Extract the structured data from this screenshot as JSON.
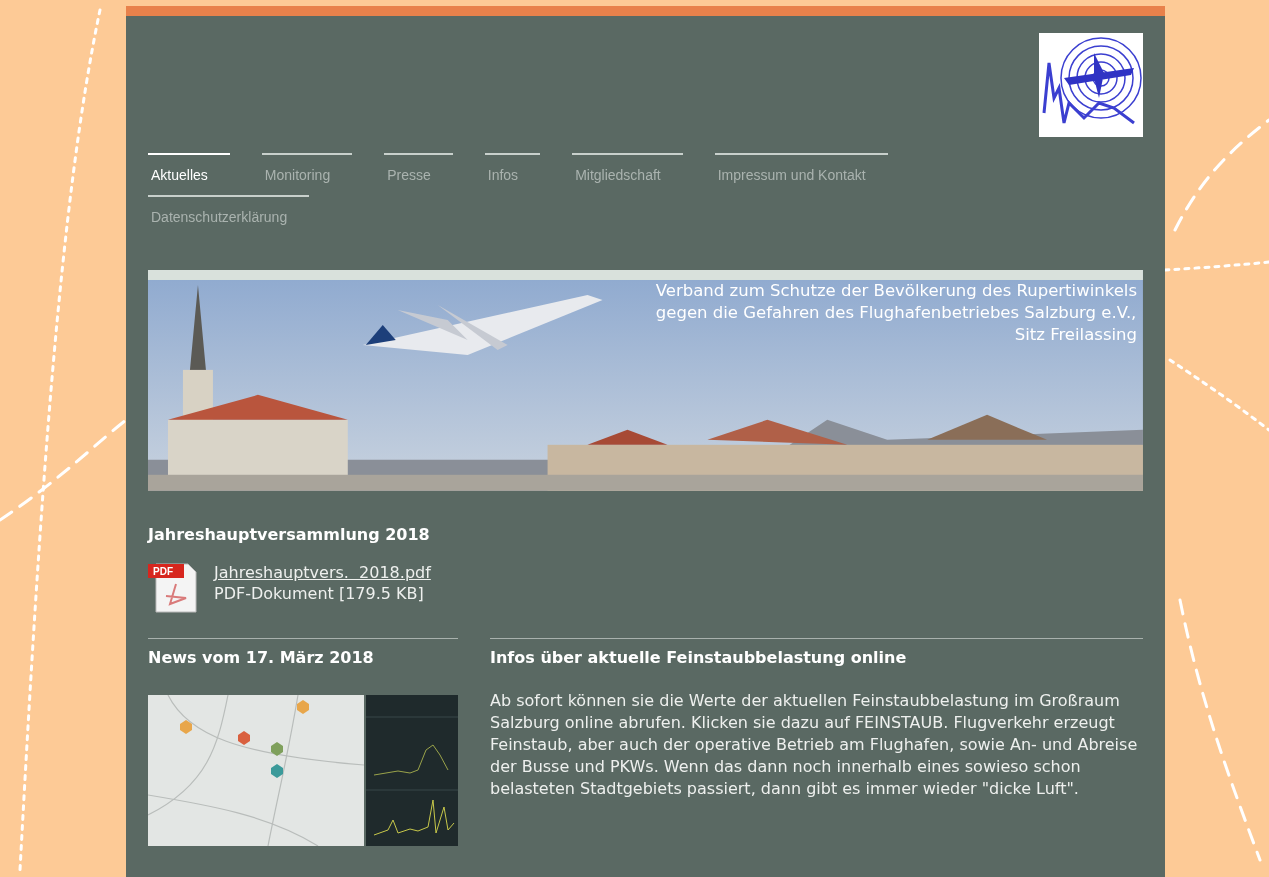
{
  "nav": [
    {
      "label": "Aktuelles",
      "selected": true
    },
    {
      "label": "Monitoring",
      "selected": false
    },
    {
      "label": "Presse",
      "selected": false
    },
    {
      "label": "Infos",
      "selected": false
    },
    {
      "label": "Mitgliedschaft",
      "selected": false
    },
    {
      "label": "Impressum und Kontakt",
      "selected": false
    },
    {
      "label": "Datenschutzerklärung",
      "selected": false
    }
  ],
  "banner": {
    "lines": [
      "Verband zum Schutze der Bevölkerung des Rupertiwinkels",
      "gegen die Gefahren des Flughafenbetriebes Salzburg e.V.,",
      "Sitz Freilassing"
    ]
  },
  "section": {
    "title": "Jahreshauptversammlung 2018"
  },
  "download": {
    "icon_label": "PDF",
    "filename": "Jahreshauptvers.  2018.pdf",
    "description": "PDF-Dokument [179.5 KB]"
  },
  "news_left": {
    "title": "News vom 17. März 2018"
  },
  "news_right": {
    "title": "Infos über aktuelle Feinstaubbelastung online",
    "body": "Ab sofort können sie die Werte der aktuellen Feinstaubbelastung im Großraum Salzburg online abrufen. Klicken sie dazu auf FEINSTAUB. Flugverkehr erzeugt Feinstaub, aber auch der operative Betrieb am Flughafen, sowie An- und Abreise der Busse und PKWs. Wenn das dann noch innerhalb eines sowieso schon belasteten Stadtgebiets passiert, dann gibt es immer wieder \"dicke Luft\"."
  }
}
